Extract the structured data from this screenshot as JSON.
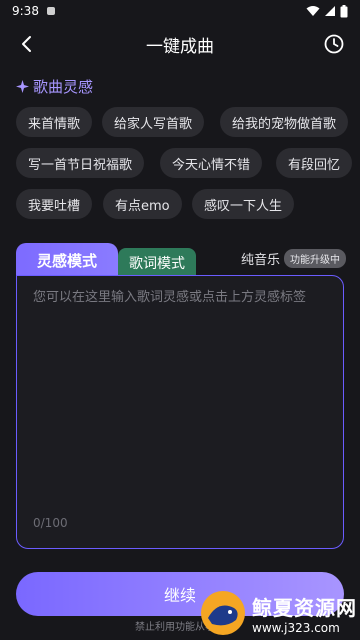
{
  "status": {
    "time": "9:38"
  },
  "nav": {
    "title": "一键成曲"
  },
  "inspiration": {
    "title": "歌曲灵感",
    "tags": [
      "来首情歌",
      "给家人写首歌",
      "给我的宠物做首歌",
      "写一首节日祝福歌",
      "今天心情不错",
      "有段回忆",
      "我要吐槽",
      "有点emo",
      "感叹一下人生"
    ]
  },
  "modes": {
    "active": "灵感模式",
    "inactive": "歌词模式",
    "pure_music": "纯音乐",
    "upgrade_badge": "功能升级中"
  },
  "input": {
    "placeholder": "您可以在这里输入歌词灵感或点击上方灵感标签",
    "counter": "0/100"
  },
  "actions": {
    "continue": "继续"
  },
  "disclaimer": "禁止利用功能从事任",
  "watermark": {
    "name": "鲸夏资源网",
    "url": "www.j323.com"
  },
  "colors": {
    "accent": "#7d6bff",
    "lyric_tab": "#2e7a5a",
    "background": "#17171b"
  }
}
